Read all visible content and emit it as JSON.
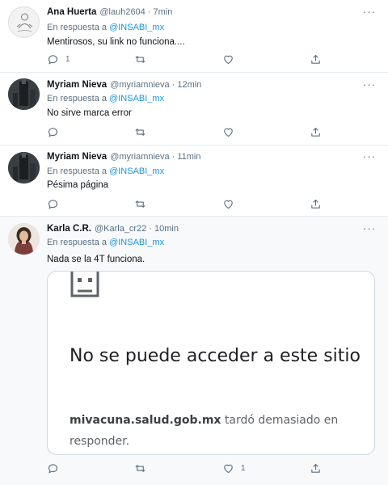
{
  "tweets": [
    {
      "name": "Ana Huerta",
      "handle": "@lauh2604",
      "separator": "·",
      "time": "7min",
      "reply_prefix": "En respuesta a",
      "reply_to": "@INSABI_mx",
      "text": "Mentirosos, su link no funciona....",
      "reply_count": "1",
      "retweet_count": "",
      "like_count": ""
    },
    {
      "name": "Myriam Nieva",
      "handle": "@myriamnieva",
      "separator": "·",
      "time": "12min",
      "reply_prefix": "En respuesta a",
      "reply_to": "@INSABI_mx",
      "text": "No sirve marca error",
      "reply_count": "",
      "retweet_count": "",
      "like_count": ""
    },
    {
      "name": "Myriam Nieva",
      "handle": "@myriamnieva",
      "separator": "·",
      "time": "11min",
      "reply_prefix": "En respuesta a",
      "reply_to": "@INSABI_mx",
      "text": "Pésima página",
      "reply_count": "",
      "retweet_count": "",
      "like_count": ""
    },
    {
      "name": "Karla C.R.",
      "handle": "@Karla_cr22",
      "separator": "·",
      "time": "10min",
      "reply_prefix": "En respuesta a",
      "reply_to": "@INSABI_mx",
      "text": "Nada se la 4T funciona.",
      "reply_count": "",
      "retweet_count": "",
      "like_count": "1",
      "image": {
        "title": "No se puede acceder a este sitio",
        "domain": "mivacuna.salud.gob.mx",
        "body_rest": " tardó demasiado en responder."
      }
    }
  ],
  "more_glyph": "···",
  "colors": {
    "link": "#1b95e0",
    "secondary_text": "#5b7083",
    "highlight_bg": "#f7f9fa",
    "divider": "#e6ecf0"
  }
}
